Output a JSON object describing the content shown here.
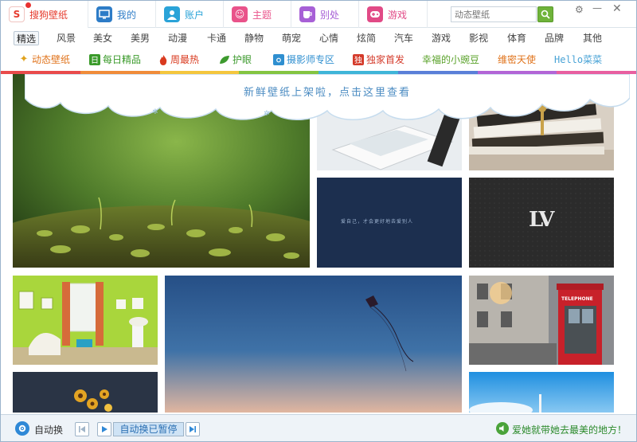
{
  "app": {
    "name": "搜狗壁纸"
  },
  "nav": {
    "tabs": [
      {
        "label": "搜狗壁纸",
        "icon": "sogou-logo-icon",
        "color": "#e63b2e"
      },
      {
        "label": "我的",
        "icon": "monitor-icon",
        "color": "#2d7cc7"
      },
      {
        "label": "账户",
        "icon": "user-icon",
        "color": "#2aa3d8"
      },
      {
        "label": "主题",
        "icon": "theme-icon",
        "color": "#e9538a"
      },
      {
        "label": "别处",
        "icon": "cup-icon",
        "color": "#a760d6"
      },
      {
        "label": "游戏",
        "icon": "gamepad-icon",
        "color": "#e14a86"
      }
    ],
    "search_placeholder": "动态壁纸"
  },
  "categories": [
    "精选",
    "风景",
    "美女",
    "美男",
    "动漫",
    "卡通",
    "静物",
    "萌宠",
    "心情",
    "炫简",
    "汽车",
    "游戏",
    "影视",
    "体育",
    "品牌",
    "其他"
  ],
  "active_category": "精选",
  "features": [
    {
      "label": "动态壁纸",
      "icon": "sparkle-icon",
      "color": "#e0731b"
    },
    {
      "label": "每日精品",
      "icon": "calendar-icon",
      "color": "#3a9a2a"
    },
    {
      "label": "周最热",
      "icon": "fire-icon",
      "color": "#d93a1f"
    },
    {
      "label": "护眼",
      "icon": "leaf-icon",
      "color": "#3d9a2e"
    },
    {
      "label": "摄影师专区",
      "icon": "camera-icon",
      "color": "#2f8fd0"
    },
    {
      "label": "独家首发",
      "icon": "exclusive-icon",
      "color": "#d43a2a"
    },
    {
      "label": "幸福的小豌豆",
      "icon": "",
      "color": "#5aa22a"
    },
    {
      "label": "维密天使",
      "icon": "",
      "color": "#e0731b"
    },
    {
      "label": "Hello菜菜",
      "icon": "",
      "color": "#49a3d6"
    }
  ],
  "banner": {
    "text": "新鲜壁纸上架啦，点击这里查看"
  },
  "tiles": [
    {
      "name": "moss-macro-wallpaper",
      "caption": ""
    },
    {
      "name": "book-desk-wallpaper",
      "caption": ""
    },
    {
      "name": "books-key-wallpaper",
      "caption": ""
    },
    {
      "name": "dark-blue-quote-wallpaper",
      "caption": "爱自己，才会更好地去爱别人"
    },
    {
      "name": "lv-logo-wallpaper",
      "caption": "LV"
    },
    {
      "name": "green-room-wallpaper",
      "caption": ""
    },
    {
      "name": "kite-sky-wallpaper",
      "caption": ""
    },
    {
      "name": "london-phonebox-wallpaper",
      "caption": "TELEPHONE"
    },
    {
      "name": "sunflower-dark-wallpaper",
      "caption": ""
    },
    {
      "name": "blue-sky-wallpaper",
      "caption": ""
    }
  ],
  "bottom": {
    "auto_switch_label": "自动换",
    "pause_text": "自动换已暂停",
    "slogan": "爱她就带她去最美的地方！"
  },
  "colors": {
    "accent_blue": "#2a6fb3",
    "rainbow": [
      "#e94b4b",
      "#f08c3a",
      "#f4c63e",
      "#84c441",
      "#3fb5d8",
      "#5a7fd8",
      "#b265d6",
      "#e85fa0"
    ]
  }
}
